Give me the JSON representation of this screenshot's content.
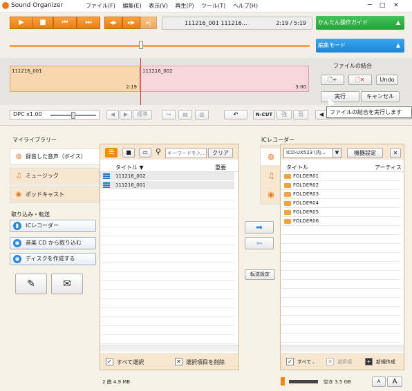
{
  "window": {
    "title": "Sound Organizer",
    "menu": [
      "ファイル(F)",
      "編集(E)",
      "表示(V)",
      "再生(P)",
      "ツール(T)",
      "ヘルプ(H)"
    ],
    "controls": [
      "－",
      "□",
      "✕"
    ]
  },
  "player": {
    "track": "111216_001 111216...",
    "time": "2:19 / 5:19",
    "progress": 0.437
  },
  "guide": {
    "label": "かんたん操作ガイド",
    "arrow": "▲"
  },
  "edit_mode": {
    "label": "編集モード",
    "arrow": "▲"
  },
  "clips": [
    {
      "name": "111216_001",
      "duration": "2:19"
    },
    {
      "name": "111216_002",
      "duration": "3:00"
    }
  ],
  "combine": {
    "title": "ファイルの結合",
    "undo": "Undo",
    "execute": "実行",
    "cancel": "キャンセル",
    "tooltip": "ファイルの結合を実行します"
  },
  "dpc": {
    "label": "DPC x1.00",
    "standard": "標準",
    "ncut": "N-CUT",
    "strong": "強",
    "weak": "弱"
  },
  "library": {
    "title": "マイライブラリー",
    "tabs": [
      "録音した音声（ボイス）",
      "ミュージック",
      "ポッドキャスト"
    ],
    "import_title": "取り込み・転送",
    "import_buttons": [
      "ICレコーダー",
      "音楽 CD から取り込む",
      "ディスクを作成する"
    ],
    "search_placeholder": "キーワードを入...",
    "clear": "クリア",
    "col_title": "タイトル ▼",
    "col_importance": "重要",
    "files": [
      "111216_002",
      "111216_001"
    ],
    "select_all": "すべて選択",
    "delete_selected": "選択項目を削除",
    "status": "2 曲 4.9 MB"
  },
  "transfer": {
    "settings": "転送設定"
  },
  "ic_recorder": {
    "title": "ICレコーダー",
    "device": "ICD-UX523 (内...",
    "device_settings": "機器設定",
    "col_title": "タイトル",
    "col_artist": "アーティスト",
    "folders": [
      "FOLDER01",
      "FOLDER02",
      "FOLDER03",
      "FOLDER04",
      "FOLDER05",
      "FOLDER06"
    ],
    "select_all": "すべて...",
    "select_item": "選択項",
    "new_folder": "新規作成",
    "free_space": "空き 3.5 GB",
    "font_small": "A",
    "font_large": "A"
  }
}
